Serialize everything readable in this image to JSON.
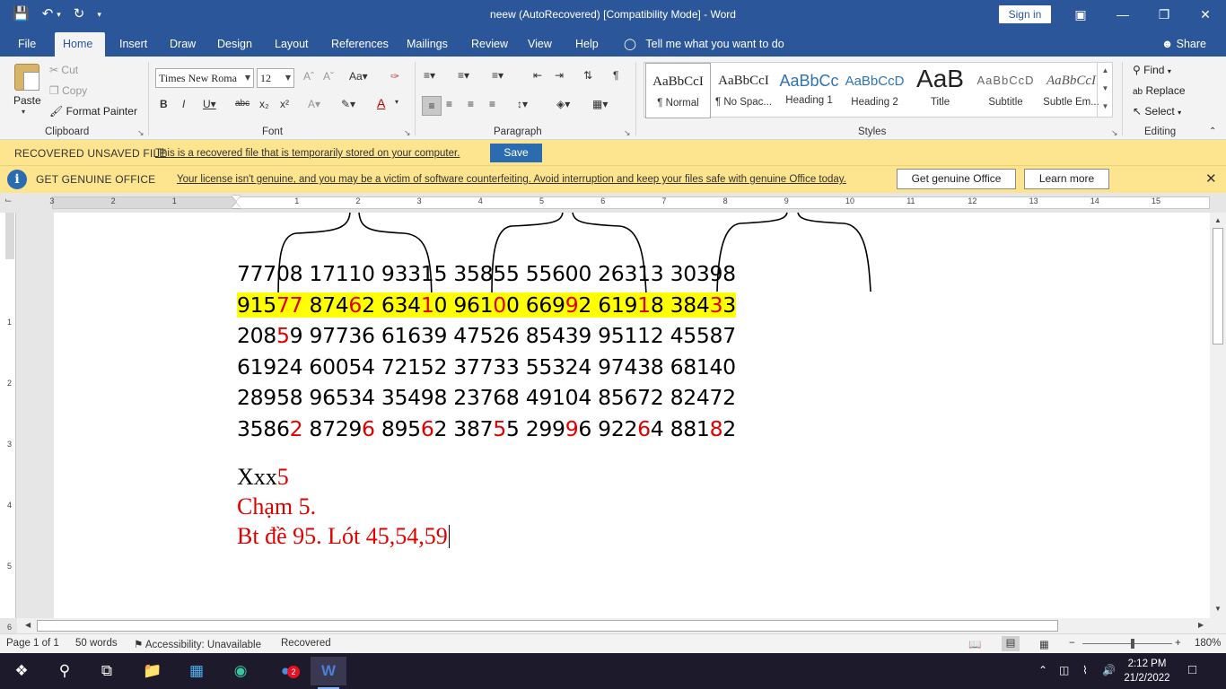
{
  "window": {
    "title": "neew (AutoRecovered) [Compatibility Mode]  -  Word",
    "sign_in": "Sign in"
  },
  "tabs": [
    "File",
    "Home",
    "Insert",
    "Draw",
    "Design",
    "Layout",
    "References",
    "Mailings",
    "Review",
    "View",
    "Help"
  ],
  "tell_me": "Tell me what you want to do",
  "share": "Share",
  "clipboard": {
    "paste": "Paste",
    "cut": "Cut",
    "copy": "Copy",
    "format_painter": "Format Painter",
    "label": "Clipboard"
  },
  "font": {
    "name": "Times New Roma",
    "size": "12",
    "label": "Font"
  },
  "paragraph": {
    "label": "Paragraph"
  },
  "styles": {
    "label": "Styles",
    "items": [
      {
        "preview": "AaBbCcI",
        "name": "¶ Normal"
      },
      {
        "preview": "AaBbCcI",
        "name": "¶ No Spac..."
      },
      {
        "preview": "AaBbCc",
        "name": "Heading 1"
      },
      {
        "preview": "AaBbCcD",
        "name": "Heading 2"
      },
      {
        "preview": "AaB",
        "name": "Title"
      },
      {
        "preview": "AaBbCcD",
        "name": "Subtitle"
      },
      {
        "preview": "AaBbCcI",
        "name": "Subtle Em..."
      }
    ]
  },
  "editing": {
    "find": "Find",
    "replace": "Replace",
    "select": "Select",
    "label": "Editing"
  },
  "recovered_bar": {
    "title": "RECOVERED UNSAVED FILE",
    "message": "This is a recovered file that is temporarily stored on your computer.",
    "save": "Save"
  },
  "genuine_bar": {
    "title": "GET GENUINE OFFICE",
    "message": "Your license isn't genuine, and you may be a victim of software counterfeiting. Avoid interruption and keep your files safe with genuine Office today.",
    "get_button": "Get genuine Office",
    "learn_button": "Learn more"
  },
  "ruler_numbers": [
    "3",
    "2",
    "1",
    "1",
    "2",
    "3",
    "4",
    "5",
    "6",
    "7",
    "8",
    "9",
    "10",
    "11",
    "12",
    "13",
    "14",
    "15"
  ],
  "vruler_numbers": [
    "1",
    "2",
    "3",
    "4",
    "5",
    "6"
  ],
  "document": {
    "number_lines": [
      [
        [
          "77708 17110 93315 35855 55600 26313 30398",
          false
        ]
      ],
      [
        [
          "915",
          false
        ],
        [
          "77",
          true
        ],
        [
          " 874",
          false
        ],
        [
          "6",
          true
        ],
        [
          "2 634",
          false
        ],
        [
          "1",
          true
        ],
        [
          "0 961",
          false
        ],
        [
          "0",
          true
        ],
        [
          "0 669",
          false
        ],
        [
          "9",
          true
        ],
        [
          "2 619",
          false
        ],
        [
          "1",
          true
        ],
        [
          "8 384",
          false
        ],
        [
          "3",
          true
        ],
        [
          "3",
          false
        ]
      ],
      [
        [
          "208",
          false
        ],
        [
          "5",
          true
        ],
        [
          "9 97736 61639 47526 85439 95112 45587",
          false
        ]
      ],
      [
        [
          "61924 60054 72152 37733 55324 97438 68140",
          false
        ]
      ],
      [
        [
          "28958 96534 35498 23768 49104 85672 82472",
          false
        ]
      ],
      [
        [
          "3586",
          false
        ],
        [
          "2",
          true
        ],
        [
          " 8729",
          false
        ],
        [
          "6",
          true
        ],
        [
          " 895",
          false
        ],
        [
          "6",
          true
        ],
        [
          "2 387",
          false
        ],
        [
          "5",
          true
        ],
        [
          "5 299",
          false
        ],
        [
          "9",
          true
        ],
        [
          "6 922",
          false
        ],
        [
          "6",
          true
        ],
        [
          "4 881",
          false
        ],
        [
          "8",
          true
        ],
        [
          "2",
          false
        ]
      ]
    ],
    "text_line_1_black": "Xxx",
    "text_line_1_red": "5",
    "text_line_2": "Chạm 5.",
    "text_line_3": "Bt đề 95. Lót 45,54,59"
  },
  "status": {
    "page": "Page 1 of 1",
    "words": "50 words",
    "accessibility": "Accessibility: Unavailable",
    "recovered": "Recovered",
    "zoom": "180%"
  },
  "taskbar": {
    "time": "2:12 PM",
    "date": "21/2/2022",
    "badge": "2"
  }
}
